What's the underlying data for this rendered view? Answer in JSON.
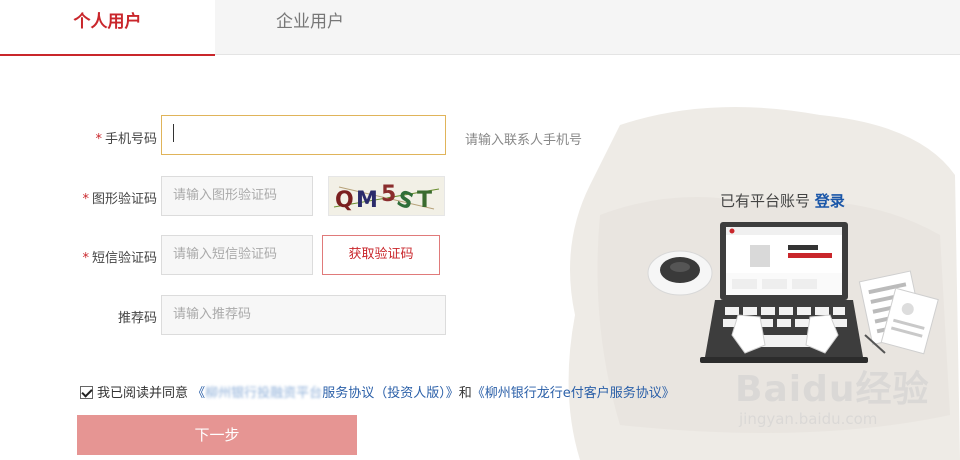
{
  "tabs": [
    {
      "label": "个人用户",
      "active": true
    },
    {
      "label": "企业用户",
      "active": false
    }
  ],
  "form": {
    "phone": {
      "required_mark": "*",
      "label": "手机号码",
      "value": "",
      "hint": "请输入联系人手机号"
    },
    "captcha": {
      "required_mark": "*",
      "label": "图形验证码",
      "placeholder": "请输入图形验证码",
      "image_text": "QM5ST"
    },
    "sms": {
      "required_mark": "*",
      "label": "短信验证码",
      "placeholder": "请输入短信验证码",
      "button": "获取验证码"
    },
    "referral": {
      "label": "推荐码",
      "placeholder": "请输入推荐码"
    }
  },
  "agreement": {
    "checked": true,
    "prefix": "我已阅读并同意",
    "open1": "《",
    "blurred": "柳州银行投融资平台",
    "link1_rest": "服务协议（投资人版）》",
    "and": "和",
    "link2": "《柳州银行龙行e付客户服务协议》"
  },
  "next_button": "下一步",
  "login": {
    "prompt": "已有平台账号",
    "link": "登录"
  },
  "watermark": {
    "main": "Baidu经验",
    "sub": "jingyan.baidu.com"
  },
  "colors": {
    "accent": "#c9262b",
    "link": "#2a5fa8",
    "next_button_bg": "#e69593"
  }
}
